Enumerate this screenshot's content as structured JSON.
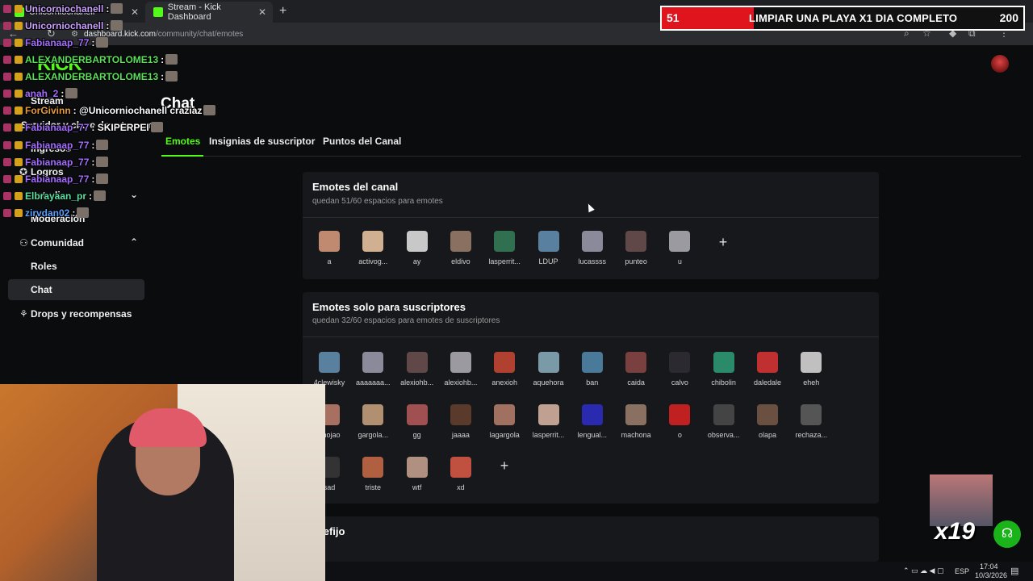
{
  "browser": {
    "tabs": [
      {
        "label": "Unicorniochanell",
        "favicon": "kick-icon"
      },
      {
        "label": "Stream - Kick Dashboard",
        "favicon": "kick-icon"
      }
    ],
    "url_domain": "dashboard.kick.com",
    "url_path": "/community/chat/emotes"
  },
  "brand": {
    "logo": "KICK",
    "accent": "#53fc18"
  },
  "sidebar": {
    "items": [
      {
        "label": "Stream",
        "icon": "broadcast-icon"
      },
      {
        "label": "Servidor y clave de retransm",
        "icon": "key-icon"
      },
      {
        "label": "Ingresos",
        "icon": "dollar-icon"
      },
      {
        "label": "Logros",
        "icon": "trophy-icon"
      },
      {
        "label": "Estudio",
        "icon": "studio-icon"
      },
      {
        "label": "Moderación",
        "icon": "shield-icon"
      },
      {
        "label": "Comunidad",
        "icon": "community-icon"
      },
      {
        "label": "Roles",
        "icon": ""
      },
      {
        "label": "Chat",
        "icon": ""
      },
      {
        "label": "Drops y recompensas",
        "icon": "gift-icon"
      }
    ]
  },
  "main": {
    "title": "Chat",
    "tabs": [
      "Emotes",
      "Insignias de suscriptor",
      "Puntos del Canal"
    ]
  },
  "channel_emotes": {
    "title": "Emotes del canal",
    "subtitle": "quedan 51/60 espacios para emotes",
    "items": [
      "a",
      "activog...",
      "ay",
      "eldivo",
      "lasperrit...",
      "LDUP",
      "lucassss",
      "punteo",
      "u"
    ]
  },
  "sub_emotes": {
    "title": "Emotes solo para suscriptores",
    "subtitle": "quedan 32/60 espacios para emotes de suscriptores",
    "items": [
      "4clewisky",
      "aaaaaaa...",
      "alexiohb...",
      "alexiohb...",
      "anexioh",
      "aquehora",
      "ban",
      "caida",
      "calvo",
      "chibolin",
      "daledale",
      "eheh",
      "enojao",
      "gargola...",
      "gg",
      "jaaaa",
      "lagargola",
      "lasperrit...",
      "lengual...",
      "machona",
      "o",
      "observa...",
      "olapa",
      "rechaza...",
      "sad",
      "triste",
      "wtf",
      "xd"
    ]
  },
  "prefix_section": {
    "title": "Prefijo"
  },
  "overlay_chat": [
    {
      "user": "Unicorniochanell",
      "msg": ":",
      "color": "#c9a0ff"
    },
    {
      "user": "Unicorniochanell",
      "msg": ":",
      "color": "#c9a0ff"
    },
    {
      "user": "Fabianaap_77",
      "msg": ":",
      "color": "#a46bff"
    },
    {
      "user": "ALEXANDERBARTOLOME13",
      "msg": ":",
      "color": "#58e058"
    },
    {
      "user": "ALEXANDERBARTOLOME13",
      "msg": ":",
      "color": "#58e058"
    },
    {
      "user": "anah_2",
      "msg": ":",
      "color": "#a46bff"
    },
    {
      "user": "ForGivinn",
      "msg": ": @Unicorniochanell craziaz",
      "color": "#e59a3a"
    },
    {
      "user": "Fabianaap_77",
      "msg": ": SKIPERPEI",
      "color": "#a46bff"
    },
    {
      "user": "Fabianaap_77",
      "msg": ":",
      "color": "#a46bff"
    },
    {
      "user": "Fabianaap_77",
      "msg": ":",
      "color": "#a46bff"
    },
    {
      "user": "Fabianaap_77",
      "msg": ":",
      "color": "#a46bff"
    },
    {
      "user": "Elbrayaan_pr",
      "msg": ":",
      "color": "#58e0a0"
    },
    {
      "user": "zirvdan02",
      "msg": ":",
      "color": "#5aa0ff"
    }
  ],
  "goal": {
    "current": "51",
    "text": "LIMPIAR UNA PLAYA X1 DIA COMPLETO",
    "max": "200",
    "progress": 0.255
  },
  "promo": {
    "multiplier": "x19"
  },
  "taskbar": {
    "lang": "ESP",
    "time": "17:04",
    "date": "10/3/2026"
  }
}
